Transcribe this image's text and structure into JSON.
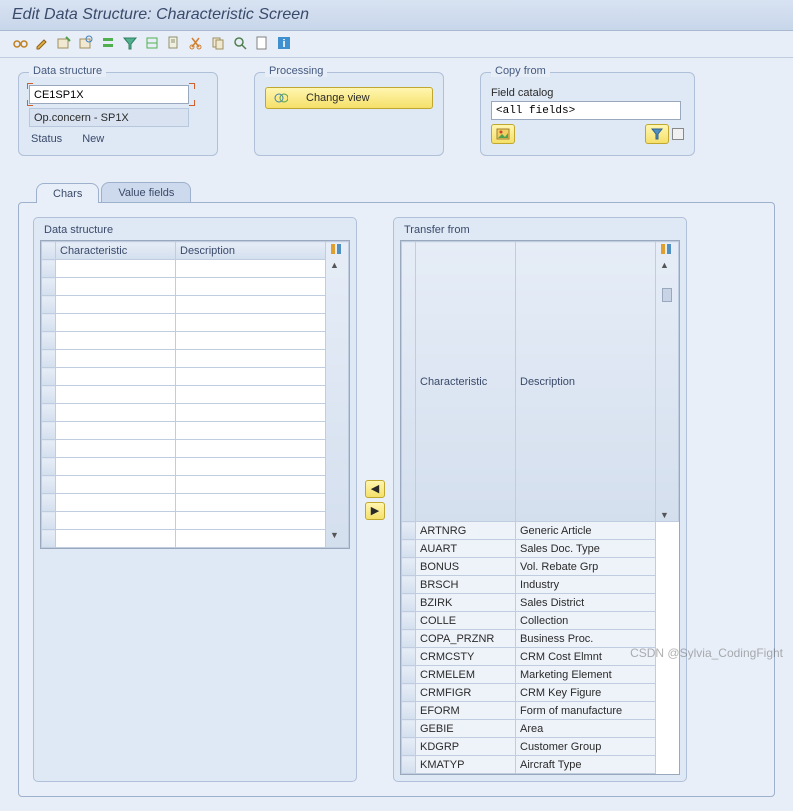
{
  "title": "Edit Data Structure: Characteristic Screen",
  "data_structure": {
    "group_label": "Data structure",
    "value": "CE1SP1X",
    "concern": "Op.concern - SP1X",
    "status_label": "Status",
    "status_value": "New"
  },
  "processing": {
    "group_label": "Processing",
    "button_label": "Change view"
  },
  "copy_from": {
    "group_label": "Copy from",
    "field_catalog_label": "Field catalog",
    "value": "<all fields>"
  },
  "tabs": {
    "chars": "Chars",
    "value_fields": "Value fields"
  },
  "left_grid": {
    "title": "Data structure",
    "col_characteristic": "Characteristic",
    "col_description": "Description"
  },
  "right_grid": {
    "title": "Transfer from",
    "col_characteristic": "Characteristic",
    "col_description": "Description",
    "rows": [
      {
        "c": "ARTNRG",
        "d": "Generic Article"
      },
      {
        "c": "AUART",
        "d": "Sales Doc. Type"
      },
      {
        "c": "BONUS",
        "d": "Vol. Rebate Grp"
      },
      {
        "c": "BRSCH",
        "d": "Industry"
      },
      {
        "c": "BZIRK",
        "d": "Sales District"
      },
      {
        "c": "COLLE",
        "d": "Collection"
      },
      {
        "c": "COPA_PRZNR",
        "d": "Business Proc."
      },
      {
        "c": "CRMCSTY",
        "d": "CRM Cost Elmnt"
      },
      {
        "c": "CRMELEM",
        "d": "Marketing Element"
      },
      {
        "c": "CRMFIGR",
        "d": "CRM Key Figure"
      },
      {
        "c": "EFORM",
        "d": "Form of manufacture"
      },
      {
        "c": "GEBIE",
        "d": "Area"
      },
      {
        "c": "KDGRP",
        "d": "Customer Group"
      },
      {
        "c": "KMATYP",
        "d": "Aircraft Type"
      }
    ]
  },
  "watermark": "CSDN @Sylvia_CodingFight"
}
